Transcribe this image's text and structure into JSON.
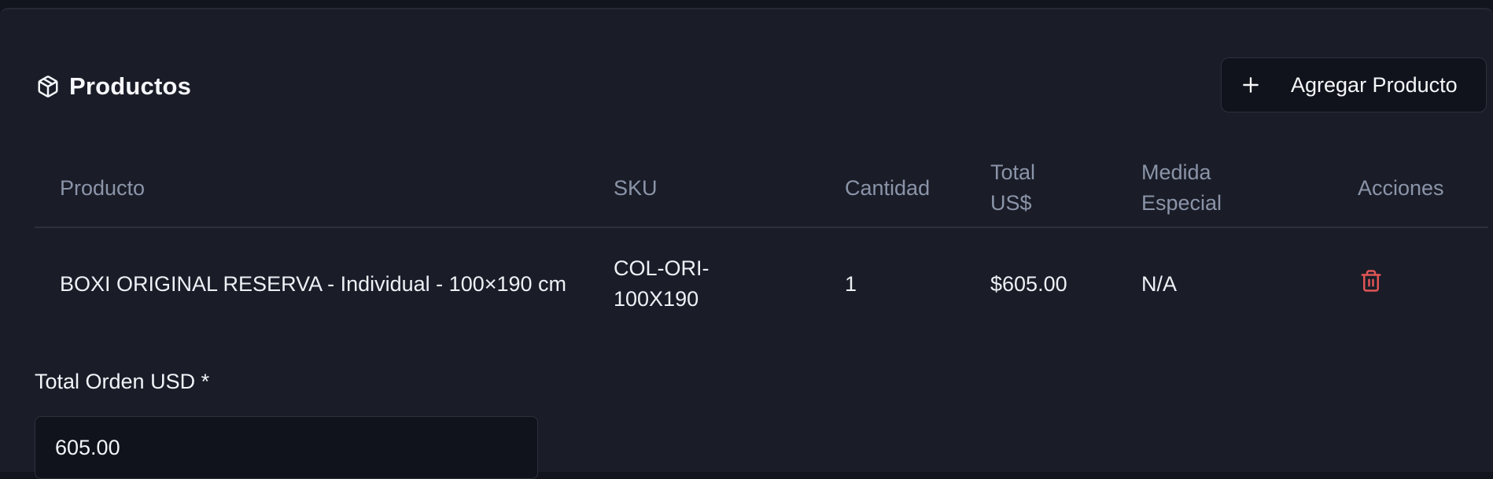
{
  "section": {
    "title": "Productos",
    "icon": "package-icon"
  },
  "add_button": {
    "icon": "plus-icon",
    "label": "Agregar Producto"
  },
  "table": {
    "headers": {
      "producto": "Producto",
      "sku": "SKU",
      "cantidad": "Cantidad",
      "total_line1": "Total",
      "total_line2": "US$",
      "medida_line1": "Medida",
      "medida_line2": "Especial",
      "acciones": "Acciones"
    },
    "rows": [
      {
        "producto": "BOXI ORIGINAL RESERVA - Individual - 100×190 cm",
        "sku": "COL-ORI-100X190",
        "cantidad": "1",
        "total": "$605.00",
        "medida_especial": "N/A",
        "action_icon": "trash-icon"
      }
    ]
  },
  "total_orden": {
    "label": "Total Orden USD *",
    "value": "605.00"
  },
  "colors": {
    "background": "#1a1d28",
    "header_text": "#8b94a8",
    "danger": "#e05555"
  }
}
